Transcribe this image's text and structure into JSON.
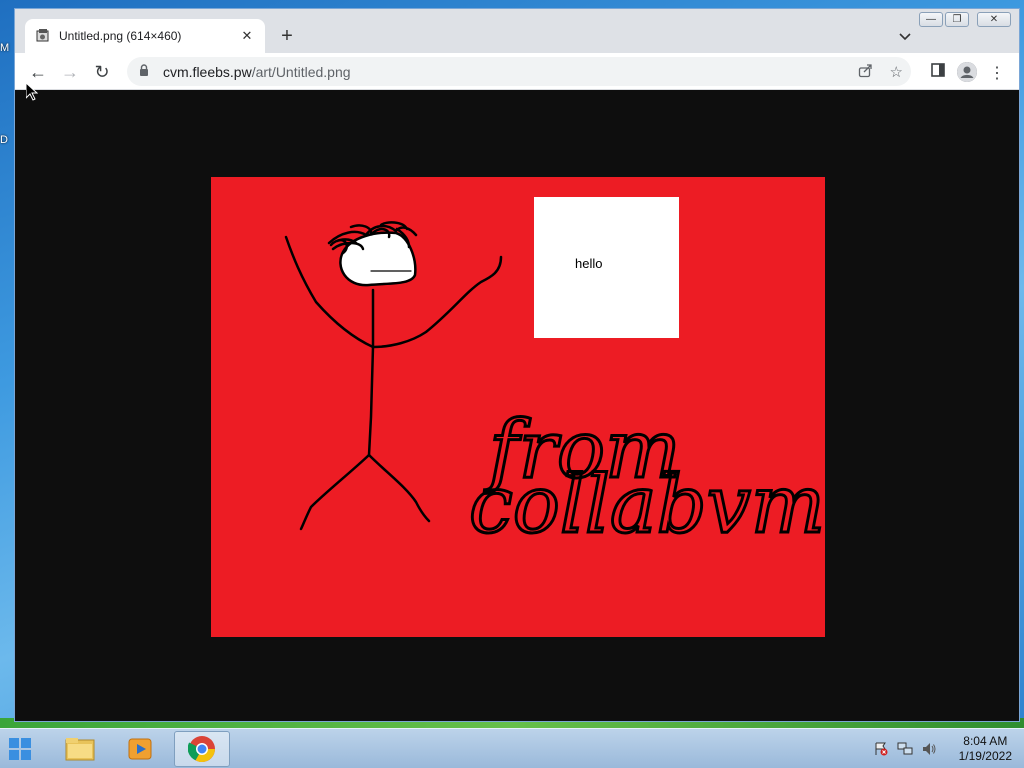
{
  "desktop": {
    "edge_labels": [
      "M",
      "D"
    ]
  },
  "browser": {
    "tab": {
      "title": "Untitled.png (614×460)",
      "favicon": "image-file-icon",
      "close_symbol": "✕"
    },
    "new_tab_symbol": "+",
    "tab_search_symbol": "⌄",
    "window_controls": {
      "minimize": "—",
      "restore": "❐",
      "close": "✕"
    },
    "nav": {
      "back": "←",
      "forward": "→",
      "reload": "↻"
    },
    "address": {
      "host": "cvm.fleebs.pw",
      "path": "/art/Untitled.png",
      "lock_symbol": "🔒"
    },
    "toolbar_icons": {
      "share": "⇪",
      "bookmark": "☆",
      "side_panel": "▮",
      "profile": "●",
      "menu": "⋮"
    }
  },
  "image": {
    "note_text": "hello",
    "handwriting": "from collabvm",
    "colors": {
      "canvas": "#ed1c24",
      "note": "#ffffff",
      "ink": "#000000"
    }
  },
  "taskbar": {
    "clock_time": "8:04 AM",
    "clock_date": "1/19/2022"
  }
}
